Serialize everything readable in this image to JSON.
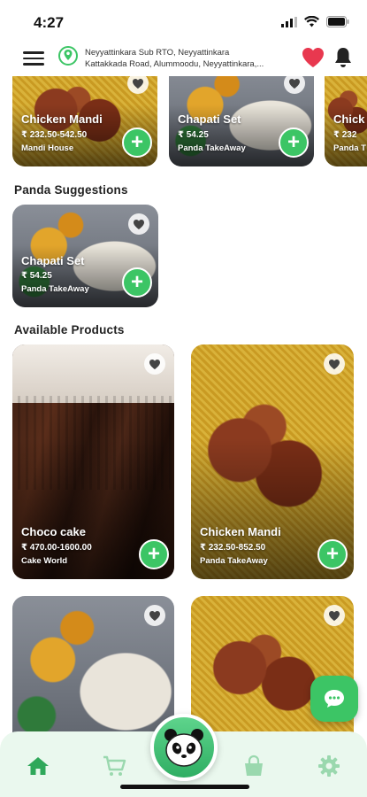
{
  "status_bar": {
    "time": "4:27"
  },
  "header": {
    "address_line1": "Neyyattinkara Sub RTO, Neyyattinkara",
    "address_line2": "Kattakkada Road, Alummoodu, Neyyattinkara,..."
  },
  "top_row": [
    {
      "name": "Chicken  Mandi",
      "price": "₹ 232.50-542.50",
      "shop": "Mandi House",
      "image": "chicken-mandi-photo"
    },
    {
      "name": "Chapati Set",
      "price": "₹ 54.25",
      "shop": "Panda TakeAway",
      "image": "chapati-set-photo"
    },
    {
      "name": "Chick",
      "price": "₹ 232",
      "shop": "Panda T",
      "image": "chicken-mandi-photo"
    }
  ],
  "suggestions": {
    "title": "Panda Suggestions",
    "items": [
      {
        "name": "Chapati Set",
        "price": "₹ 54.25",
        "shop": "Panda TakeAway",
        "image": "chapati-set-photo"
      }
    ]
  },
  "available": {
    "title": "Available Products",
    "items": [
      {
        "name": "Choco cake",
        "price": "₹ 470.00-1600.00",
        "shop": "Cake World",
        "image": "chocolate-cake-photo"
      },
      {
        "name": "Chicken Mandi",
        "price": "₹ 232.50-852.50",
        "shop": "Panda TakeAway",
        "image": "chicken-mandi-photo"
      },
      {
        "name": "",
        "price": "",
        "shop": "",
        "image": "chapati-set-photo"
      },
      {
        "name": "",
        "price": "",
        "shop": "",
        "image": "chicken-mandi-photo"
      }
    ]
  },
  "bottom_nav": [
    "home-icon",
    "cart-icon",
    "panda-icon",
    "shopping-bag-icon",
    "settings-icon"
  ],
  "colors": {
    "accent_green": "#3cc565",
    "heart_red": "#e8384f",
    "nav_bg": "#eaf8ee"
  }
}
